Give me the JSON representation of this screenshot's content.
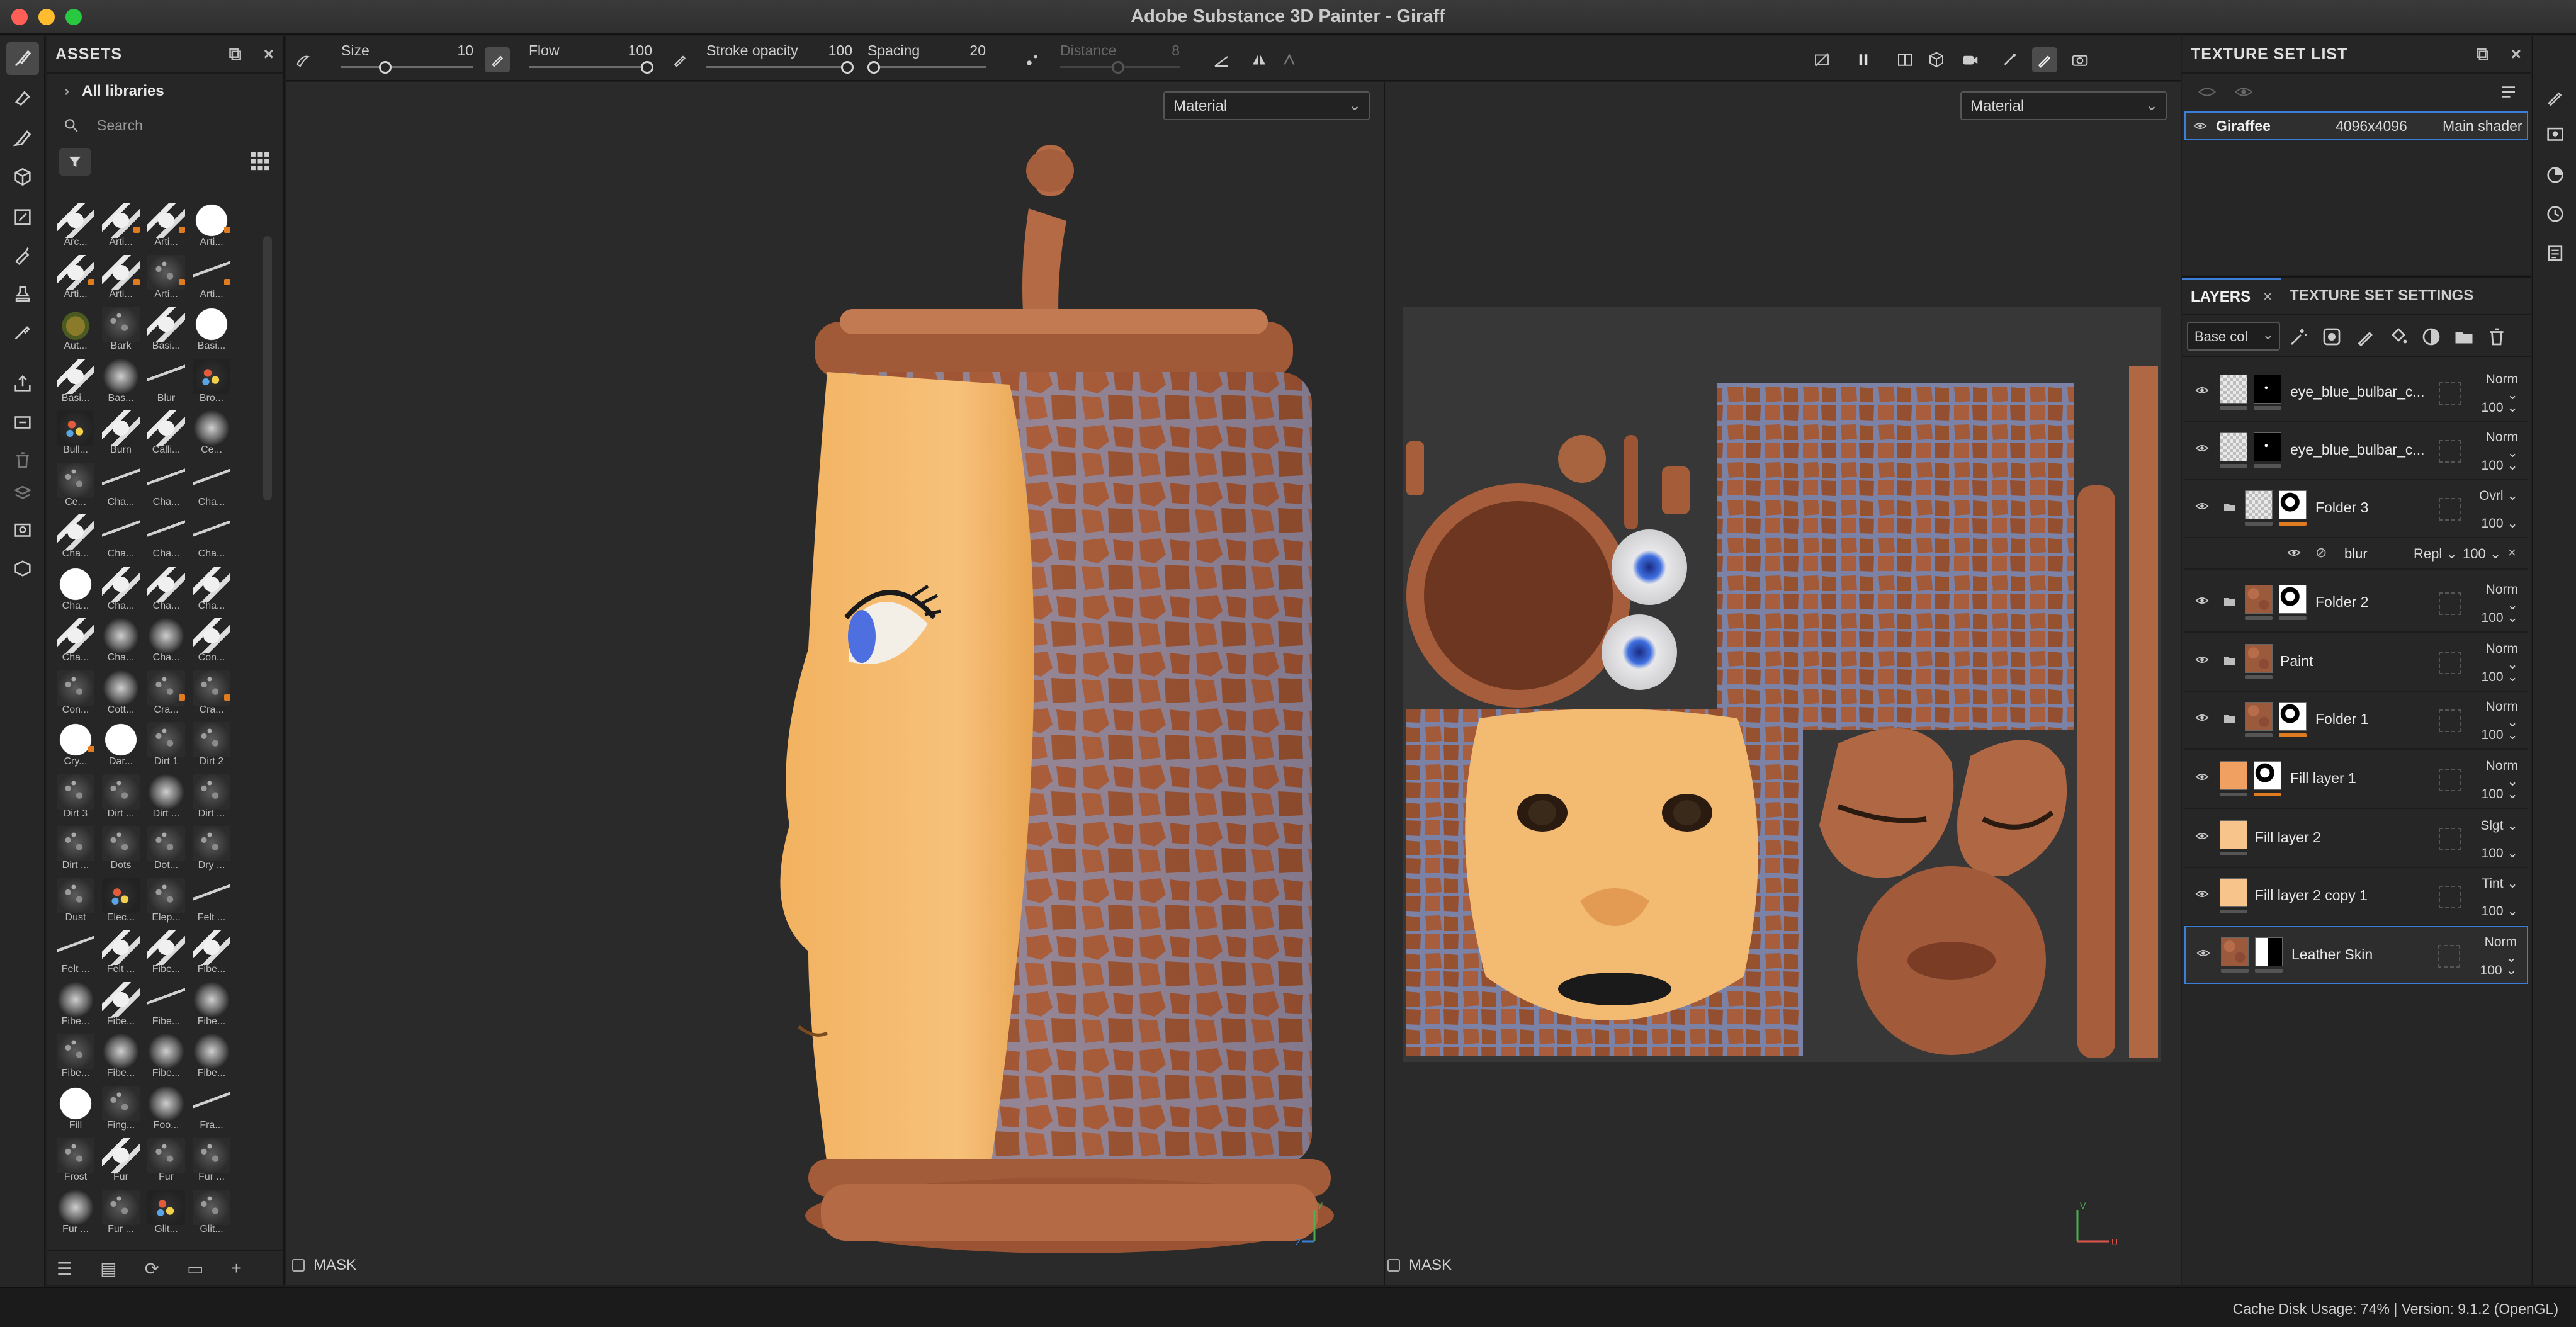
{
  "window": {
    "title": "Adobe Substance 3D Painter - Giraff"
  },
  "tool_properties": {
    "size_label": "Size",
    "size_value": "10",
    "flow_label": "Flow",
    "flow_value": "100",
    "stroke_opacity_label": "Stroke opacity",
    "stroke_opacity_value": "100",
    "spacing_label": "Spacing",
    "spacing_value": "20",
    "distance_label": "Distance",
    "distance_value": "8"
  },
  "assets": {
    "title": "ASSETS",
    "library": "All libraries",
    "search_placeholder": "Search",
    "brushes": [
      {
        "label": "Arc...",
        "style": "t-stroke"
      },
      {
        "label": "Arti...",
        "style": "t-stroke",
        "mark": true
      },
      {
        "label": "Arti...",
        "style": "t-stroke",
        "mark": true
      },
      {
        "label": "Arti...",
        "style": "t-white",
        "mark": true
      },
      {
        "label": "Arti...",
        "style": "t-stroke",
        "mark": true
      },
      {
        "label": "Arti...",
        "style": "t-stroke",
        "mark": true
      },
      {
        "label": "Arti...",
        "style": "t-noise",
        "mark": true
      },
      {
        "label": "Arti...",
        "style": "t-line",
        "mark": true
      },
      {
        "label": "Aut...",
        "style": "t-leaf"
      },
      {
        "label": "Bark",
        "style": "t-noise"
      },
      {
        "label": "Basi...",
        "style": "t-stroke"
      },
      {
        "label": "Basi...",
        "style": "t-white"
      },
      {
        "label": "Basi...",
        "style": "t-stroke"
      },
      {
        "label": "Bas...",
        "style": "t-soft"
      },
      {
        "label": "Blur",
        "style": "t-line"
      },
      {
        "label": "Bro...",
        "style": "t-color"
      },
      {
        "label": "Bull...",
        "style": "t-color"
      },
      {
        "label": "Burn",
        "style": "t-stroke"
      },
      {
        "label": "Calli...",
        "style": "t-stroke"
      },
      {
        "label": "Ce...",
        "style": "t-soft"
      },
      {
        "label": "Ce...",
        "style": "t-noise"
      },
      {
        "label": "Cha...",
        "style": "t-line"
      },
      {
        "label": "Cha...",
        "style": "t-line"
      },
      {
        "label": "Cha...",
        "style": "t-line"
      },
      {
        "label": "Cha...",
        "style": "t-stroke"
      },
      {
        "label": "Cha...",
        "style": "t-line"
      },
      {
        "label": "Cha...",
        "style": "t-line"
      },
      {
        "label": "Cha...",
        "style": "t-line"
      },
      {
        "label": "Cha...",
        "style": "t-white"
      },
      {
        "label": "Cha...",
        "style": "t-stroke"
      },
      {
        "label": "Cha...",
        "style": "t-stroke"
      },
      {
        "label": "Cha...",
        "style": "t-stroke"
      },
      {
        "label": "Cha...",
        "style": "t-stroke"
      },
      {
        "label": "Cha...",
        "style": "t-soft"
      },
      {
        "label": "Cha...",
        "style": "t-soft"
      },
      {
        "label": "Con...",
        "style": "t-stroke"
      },
      {
        "label": "Con...",
        "style": "t-noise"
      },
      {
        "label": "Cott...",
        "style": "t-soft"
      },
      {
        "label": "Cra...",
        "style": "t-noise",
        "mark": true
      },
      {
        "label": "Cra...",
        "style": "t-noise",
        "mark": true
      },
      {
        "label": "Cry...",
        "style": "t-white",
        "mark": true
      },
      {
        "label": "Dar...",
        "style": "t-white"
      },
      {
        "label": "Dirt 1",
        "style": "t-noise"
      },
      {
        "label": "Dirt 2",
        "style": "t-noise"
      },
      {
        "label": "Dirt 3",
        "style": "t-noise"
      },
      {
        "label": "Dirt ...",
        "style": "t-noise"
      },
      {
        "label": "Dirt ...",
        "style": "t-soft"
      },
      {
        "label": "Dirt ...",
        "style": "t-noise"
      },
      {
        "label": "Dirt ...",
        "style": "t-noise"
      },
      {
        "label": "Dots",
        "style": "t-noise"
      },
      {
        "label": "Dot...",
        "style": "t-noise"
      },
      {
        "label": "Dry ...",
        "style": "t-noise"
      },
      {
        "label": "Dust",
        "style": "t-noise"
      },
      {
        "label": "Elec...",
        "style": "t-color"
      },
      {
        "label": "Elep...",
        "style": "t-noise"
      },
      {
        "label": "Felt ...",
        "style": "t-line"
      },
      {
        "label": "Felt ...",
        "style": "t-line"
      },
      {
        "label": "Felt ...",
        "style": "t-stroke"
      },
      {
        "label": "Fibe...",
        "style": "t-stroke"
      },
      {
        "label": "Fibe...",
        "style": "t-stroke"
      },
      {
        "label": "Fibe...",
        "style": "t-soft"
      },
      {
        "label": "Fibe...",
        "style": "t-stroke"
      },
      {
        "label": "Fibe...",
        "style": "t-line"
      },
      {
        "label": "Fibe...",
        "style": "t-soft"
      },
      {
        "label": "Fibe...",
        "style": "t-noise"
      },
      {
        "label": "Fibe...",
        "style": "t-soft"
      },
      {
        "label": "Fibe...",
        "style": "t-soft"
      },
      {
        "label": "Fibe...",
        "style": "t-soft"
      },
      {
        "label": "Fill",
        "style": "t-white"
      },
      {
        "label": "Fing...",
        "style": "t-noise"
      },
      {
        "label": "Foo...",
        "style": "t-soft"
      },
      {
        "label": "Fra...",
        "style": "t-line"
      },
      {
        "label": "Frost",
        "style": "t-noise"
      },
      {
        "label": "Fur",
        "style": "t-stroke"
      },
      {
        "label": "Fur",
        "style": "t-noise"
      },
      {
        "label": "Fur ...",
        "style": "t-noise"
      },
      {
        "label": "Fur ...",
        "style": "t-soft"
      },
      {
        "label": "Fur ...",
        "style": "t-noise"
      },
      {
        "label": "Glit...",
        "style": "t-color"
      },
      {
        "label": "Glit...",
        "style": "t-noise"
      }
    ]
  },
  "viewport3d": {
    "material_select": "Material",
    "mask_label": "MASK",
    "axis_y": "Y",
    "axis_z": "Z"
  },
  "viewport2d": {
    "material_select": "Material",
    "mask_label": "MASK",
    "axis_v": "V",
    "axis_u": "U"
  },
  "texture_set_list": {
    "title": "TEXTURE SET LIST",
    "row": {
      "name": "Giraffee",
      "resolution": "4096x4096",
      "shader": "Main shader"
    }
  },
  "layers_panel": {
    "tab_layers": "LAYERS",
    "tab_texture_settings": "TEXTURE SET SETTINGS",
    "channel": "Base col",
    "layers": [
      {
        "name": "eye_blue_bulbar_c...",
        "blend": "Norm",
        "opacity": "100",
        "th1": "th-check",
        "th2": "th-blackdot",
        "folder": false
      },
      {
        "name": "eye_blue_bulbar_c...",
        "blend": "Norm",
        "opacity": "100",
        "th1": "th-check",
        "th2": "th-blackdot",
        "folder": false
      },
      {
        "name": "Folder 3",
        "blend": "Ovrl",
        "opacity": "100",
        "th1": "th-check",
        "th2": "th-blob",
        "folder": true,
        "sub2": "or"
      },
      {
        "name": "Folder 2",
        "blend": "Norm",
        "opacity": "100",
        "th1": "th-leather",
        "th2": "th-blob",
        "folder": true
      },
      {
        "name": "Paint",
        "blend": "Norm",
        "opacity": "100",
        "th1": "th-leather",
        "th2": "",
        "folder": true
      },
      {
        "name": "Folder 1",
        "blend": "Norm",
        "opacity": "100",
        "th1": "th-leather",
        "th2": "th-blob",
        "folder": true,
        "sub2": "or"
      },
      {
        "name": "Fill layer 1",
        "blend": "Norm",
        "opacity": "100",
        "th1": "th-orange",
        "th2": "th-blob",
        "folder": false,
        "sub2": "or"
      },
      {
        "name": "Fill layer 2",
        "blend": "Slgt",
        "opacity": "100",
        "th1": "th-peach",
        "th2": "",
        "folder": false
      },
      {
        "name": "Fill layer 2 copy 1",
        "blend": "Tint",
        "opacity": "100",
        "th1": "th-peach",
        "th2": "",
        "folder": false
      },
      {
        "name": "Leather Skin",
        "blend": "Norm",
        "opacity": "100",
        "th1": "th-leather",
        "th2": "th-blackwhite",
        "folder": false,
        "selected": true
      }
    ],
    "effect": {
      "name": "blur",
      "blend": "Repl",
      "opacity": "100"
    }
  },
  "status": {
    "text": "Cache Disk Usage:     74% | Version: 9.1.2 (OpenGL)"
  },
  "colors": {
    "accent": "#3b7fd6",
    "orange_mark": "#e07b1f",
    "panel_bg": "#262626",
    "viewport_bg": "#2a2a2a"
  }
}
